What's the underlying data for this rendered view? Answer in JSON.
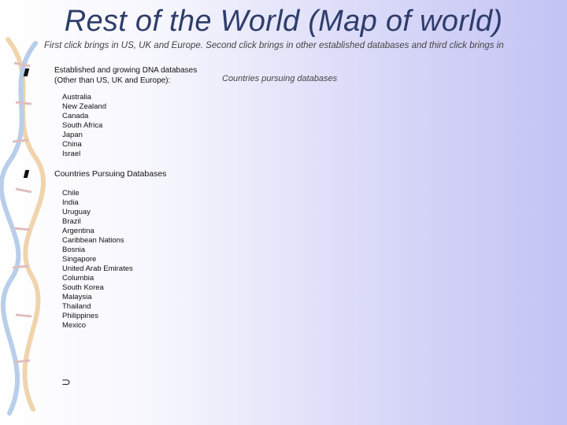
{
  "title": "Rest of the World (Map of world)",
  "subtitle": "First click brings in US, UK and Europe.  Second click brings in other established databases and third click brings in",
  "section1": {
    "heading_line1": "Established and growing DNA databases",
    "heading_line2": "(Other than US, UK and Europe):",
    "countries": [
      "Australia",
      "New Zealand",
      "Canada",
      "South Africa",
      "Japan",
      "China",
      "Israel"
    ]
  },
  "side_note": "Countries pursuing databases",
  "section2": {
    "heading": "Countries Pursuing Databases",
    "countries": [
      "Chile",
      "India",
      "Uruguay",
      "Brazil",
      "Argentina",
      "Caribbean Nations",
      "Bosnia",
      "Singapore",
      "United Arab Emirates",
      "Columbia",
      "South Korea",
      "Malaysia",
      "Thailand",
      "Philippines",
      "Mexico"
    ]
  },
  "footer_symbol": "⊃"
}
